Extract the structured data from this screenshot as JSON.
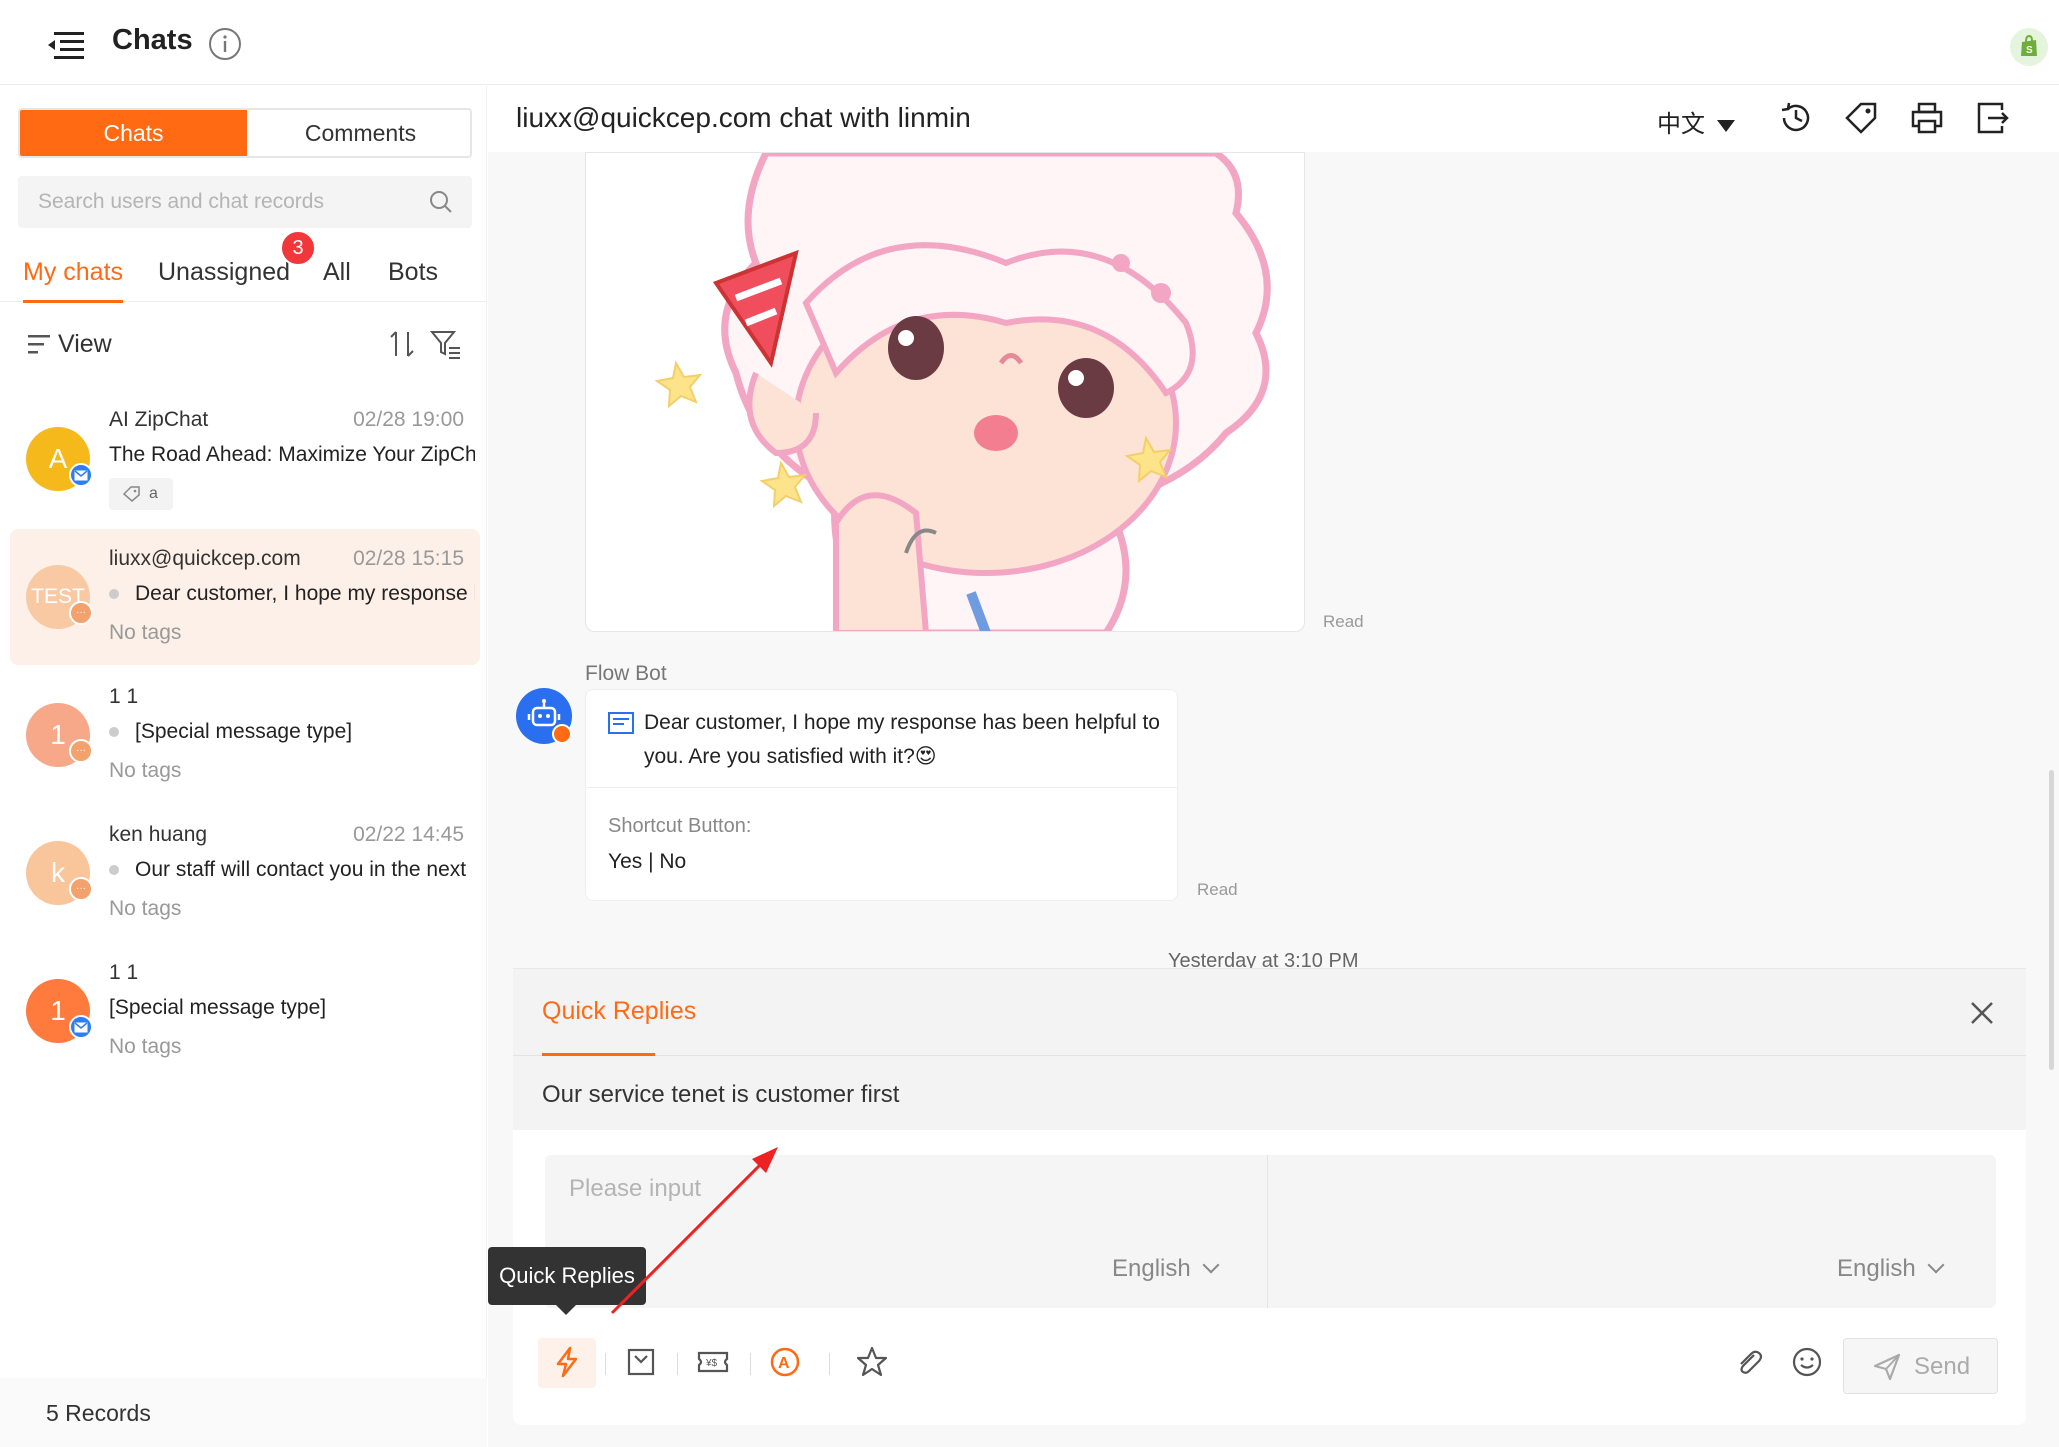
{
  "header": {
    "title": "Chats"
  },
  "left": {
    "tab_chats": "Chats",
    "tab_comments": "Comments",
    "search_placeholder": "Search users and chat records",
    "subtabs": {
      "my_chats": "My chats",
      "unassigned": "Unassigned",
      "all": "All",
      "bots": "Bots"
    },
    "unassigned_badge": "3",
    "view_label": "View",
    "chats": [
      {
        "avatar": "A",
        "avatar_color": "#f5b91c",
        "channel": "mail-icon",
        "name": "AI ZipChat",
        "time": "02/28 19:00",
        "preview": "The Road Ahead: Maximize Your ZipChat",
        "tag": "a",
        "selected": false
      },
      {
        "avatar": "TEST",
        "avatar_color": "#f9c9a3",
        "channel": "chat-icon",
        "name": "liuxx@quickcep.com",
        "time": "02/28 15:15",
        "preview": "Dear customer, I hope my response has been helpful",
        "tag": "No tags",
        "selected": true
      },
      {
        "avatar": "1",
        "avatar_color": "#f7a888",
        "channel": "chat-icon",
        "name": "1 1",
        "time": "",
        "preview": "[Special message type]",
        "tag": "No tags",
        "selected": false
      },
      {
        "avatar": "k",
        "avatar_color": "#f9c59b",
        "channel": "chat-icon",
        "name": "ken huang",
        "time": "02/22 14:45",
        "preview": "Our staff will contact you in the next",
        "tag": "No tags",
        "selected": false
      },
      {
        "avatar": "1",
        "avatar_color": "#ff7a3d",
        "channel": "mail-icon",
        "name": "1 1",
        "time": "",
        "preview": "[Special message type]",
        "tag": "No tags",
        "selected": false
      }
    ],
    "records": "5 Records"
  },
  "chat": {
    "title": "liuxx@quickcep.com chat with linmin",
    "language": "中文",
    "image_read": "Read",
    "bot_name": "Flow Bot",
    "bot_message": "Dear customer, I hope my response has been helpful to you. Are you satisfied with it?😍",
    "shortcut_label": "Shortcut Button:",
    "shortcut_value": "Yes | No",
    "bot_read": "Read",
    "separator_time": "Yesterday at 3:10 PM"
  },
  "quick_replies": {
    "title": "Quick Replies",
    "item": "Our service tenet is customer first"
  },
  "composer": {
    "placeholder": "Please input",
    "source_lang": "English",
    "target_lang": "English",
    "send_label": "Send",
    "tooltip": "Quick Replies"
  },
  "colors": {
    "accent": "#ff6a13",
    "badge": "#f2373b",
    "bot_blue": "#2a6ff0"
  }
}
